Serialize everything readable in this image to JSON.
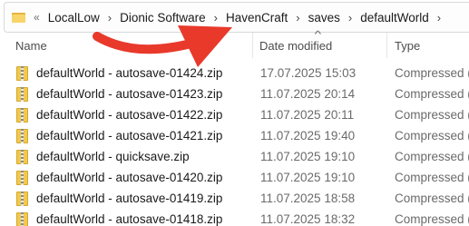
{
  "addressbar": {
    "overflow_glyph": "«",
    "crumbs": [
      "LocalLow",
      "Dionic Software",
      "HavenCraft",
      "saves",
      "defaultWorld"
    ],
    "separator": "›"
  },
  "columns": {
    "name": "Name",
    "date": "Date modified",
    "type": "Type",
    "sort_glyph": "^"
  },
  "files": [
    {
      "name": "defaultWorld - autosave-01424.zip",
      "date": "17.07.2025 15:03",
      "type": "Compressed (zi"
    },
    {
      "name": "defaultWorld - autosave-01423.zip",
      "date": "11.07.2025 20:14",
      "type": "Compressed (zi"
    },
    {
      "name": "defaultWorld - autosave-01422.zip",
      "date": "11.07.2025 20:11",
      "type": "Compressed (zi"
    },
    {
      "name": "defaultWorld - autosave-01421.zip",
      "date": "11.07.2025 19:40",
      "type": "Compressed (zi"
    },
    {
      "name": "defaultWorld - quicksave.zip",
      "date": "11.07.2025 19:10",
      "type": "Compressed (zi"
    },
    {
      "name": "defaultWorld - autosave-01420.zip",
      "date": "11.07.2025 19:10",
      "type": "Compressed (zi"
    },
    {
      "name": "defaultWorld - autosave-01419.zip",
      "date": "11.07.2025 18:58",
      "type": "Compressed (zi"
    },
    {
      "name": "defaultWorld - autosave-01418.zip",
      "date": "11.07.2025 18:32",
      "type": "Compressed (zi"
    }
  ],
  "colors": {
    "annotation_arrow": "#e8392b",
    "folder": "#f7d56a",
    "zip_icon": "#f2c94c"
  },
  "icons": {
    "folder": "folder-icon",
    "zip": "zip-folder-icon",
    "annotation": "red-arrow-annotation"
  }
}
